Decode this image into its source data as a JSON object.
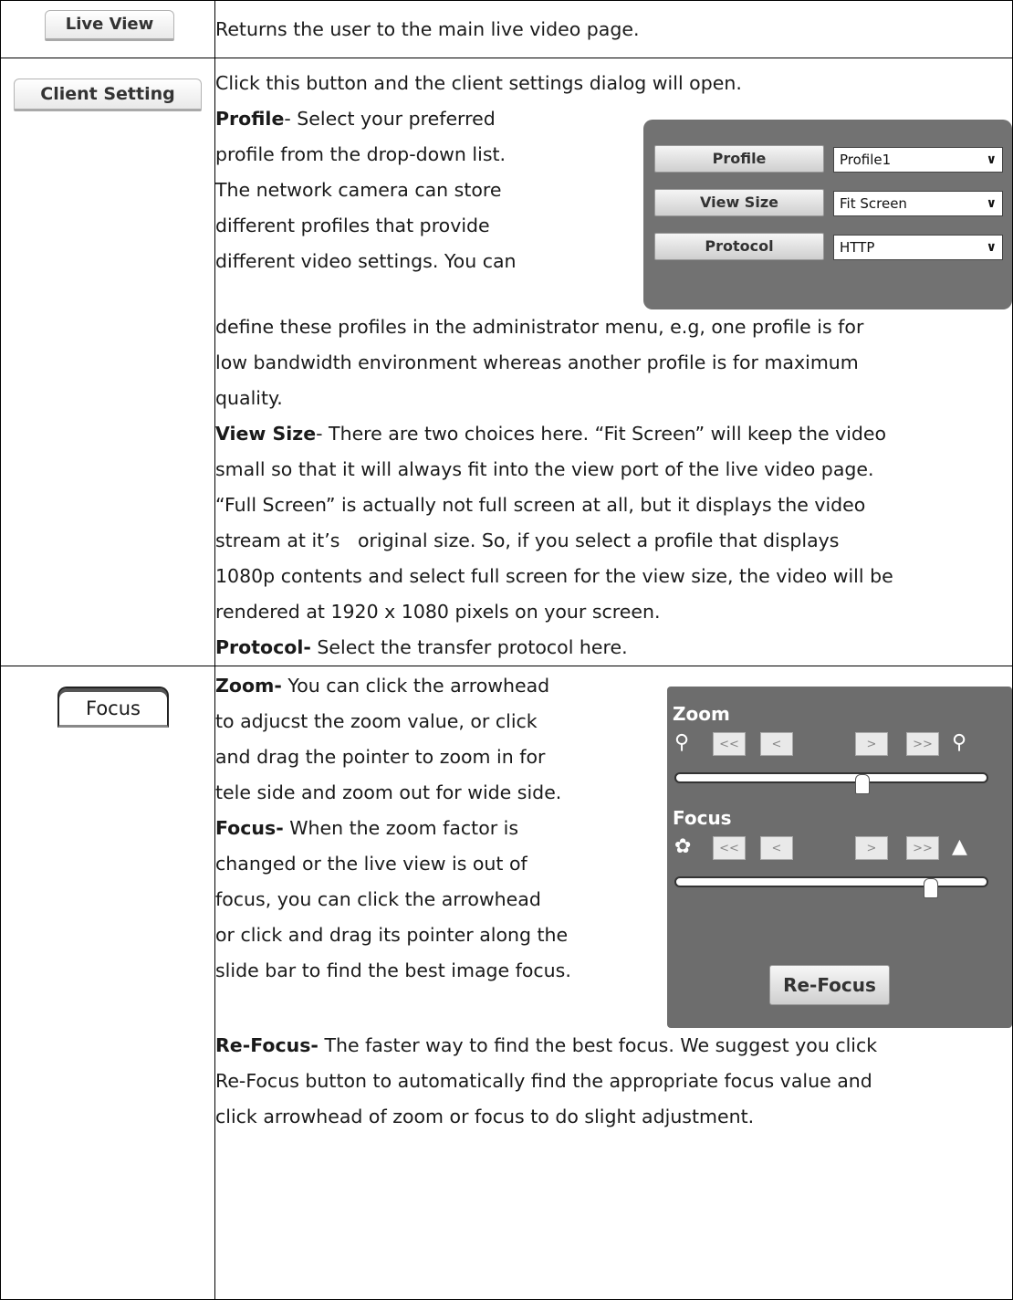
{
  "rows": [
    {
      "button": "Live View",
      "lines": [
        "Returns the user to the main live video page."
      ]
    },
    {
      "button": "Client Setting",
      "intro": "Click this button and the client settings dialog will open.",
      "profile": {
        "term": "Profile",
        "wrap_lines": [
          "- Select your preferred",
          "profile from the drop-down list.",
          "The network camera can store",
          "different profiles that provide",
          "different video settings. You can"
        ],
        "after_lines": [
          "define these profiles in the administrator menu, e.g, one profile is for",
          "low bandwidth environment whereas another profile is for maximum",
          "quality."
        ]
      },
      "view_size": {
        "term": "View Size",
        "first": "- There are two choices here. “Fit Screen” will keep the video",
        "lines": [
          "small so that it will always fit into the view port of the live video page.",
          "“Full Screen” is actually not full screen at all, but it displays the video",
          "stream at it’s   original size. So, if you select a profile that displays",
          "1080p contents and select full screen for the view size, the video will be",
          "rendered at 1920 x 1080 pixels on your screen."
        ]
      },
      "protocol": {
        "term": "Protocol-",
        "text": " Select the transfer protocol here."
      },
      "panel": {
        "rows": [
          {
            "label": "Profile",
            "value": "Profile1"
          },
          {
            "label": "View Size",
            "value": "Fit Screen"
          },
          {
            "label": "Protocol",
            "value": "HTTP"
          }
        ]
      }
    },
    {
      "button": "Focus",
      "zoom": {
        "term": "Zoom-",
        "first": " You can click the arrowhead",
        "lines": [
          "to adjucst the zoom value, or click",
          "and drag the pointer to zoom in for",
          "tele side and zoom out for wide side."
        ]
      },
      "focus": {
        "term": "Focus-",
        "first": " When the zoom factor is",
        "lines": [
          "changed or the live view is out of",
          "focus, you can click the arrowhead",
          "or click and drag its pointer along the",
          "slide bar to find the best image focus."
        ]
      },
      "refocus": {
        "term": "Re-Focus-",
        "first": " The faster way to find the best focus. We suggest you click",
        "lines": [
          "Re-Focus button to automatically find the appropriate focus value and",
          "click arrowhead of zoom or focus to do slight adjustment."
        ]
      },
      "panel": {
        "zoom_title": "Zoom",
        "focus_title": "Focus",
        "btn_first": "<<",
        "btn_prev": "<",
        "btn_next": ">",
        "btn_last": ">>",
        "refocus_label": "Re-Focus",
        "zoom_slider_fraction": 0.6,
        "focus_slider_fraction": 0.82
      }
    }
  ],
  "icons": [
    "zoom-out-icon",
    "zoom-in-icon",
    "focus-near-icon",
    "focus-far-icon",
    "chevron-down-icon"
  ]
}
